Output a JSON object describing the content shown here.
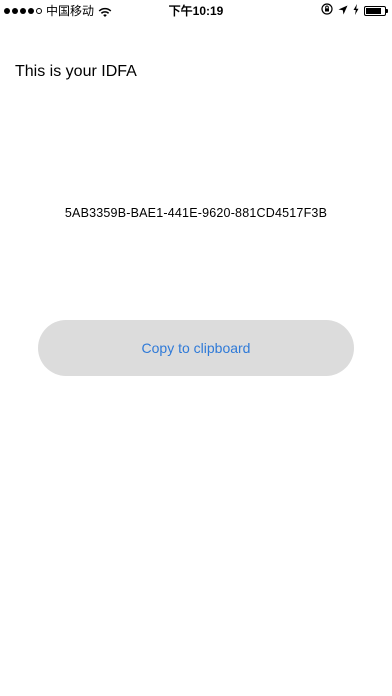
{
  "status_bar": {
    "signal_bars_filled": 4,
    "signal_bars_total": 5,
    "carrier": "中国移动",
    "time": "下午10:19",
    "battery_level": 0.85,
    "icons": [
      "wifi-icon",
      "orientation-lock-icon",
      "location-arrow-icon",
      "charging-bolt-icon",
      "battery-icon"
    ]
  },
  "main": {
    "title": "This is your IDFA",
    "idfa": "5AB3359B-BAE1-441E-9620-881CD4517F3B",
    "copy_button_label": "Copy to clipboard"
  },
  "colors": {
    "accent": "#2f7ad8",
    "button_bg": "#dcdcdc",
    "background": "#ffffff"
  }
}
